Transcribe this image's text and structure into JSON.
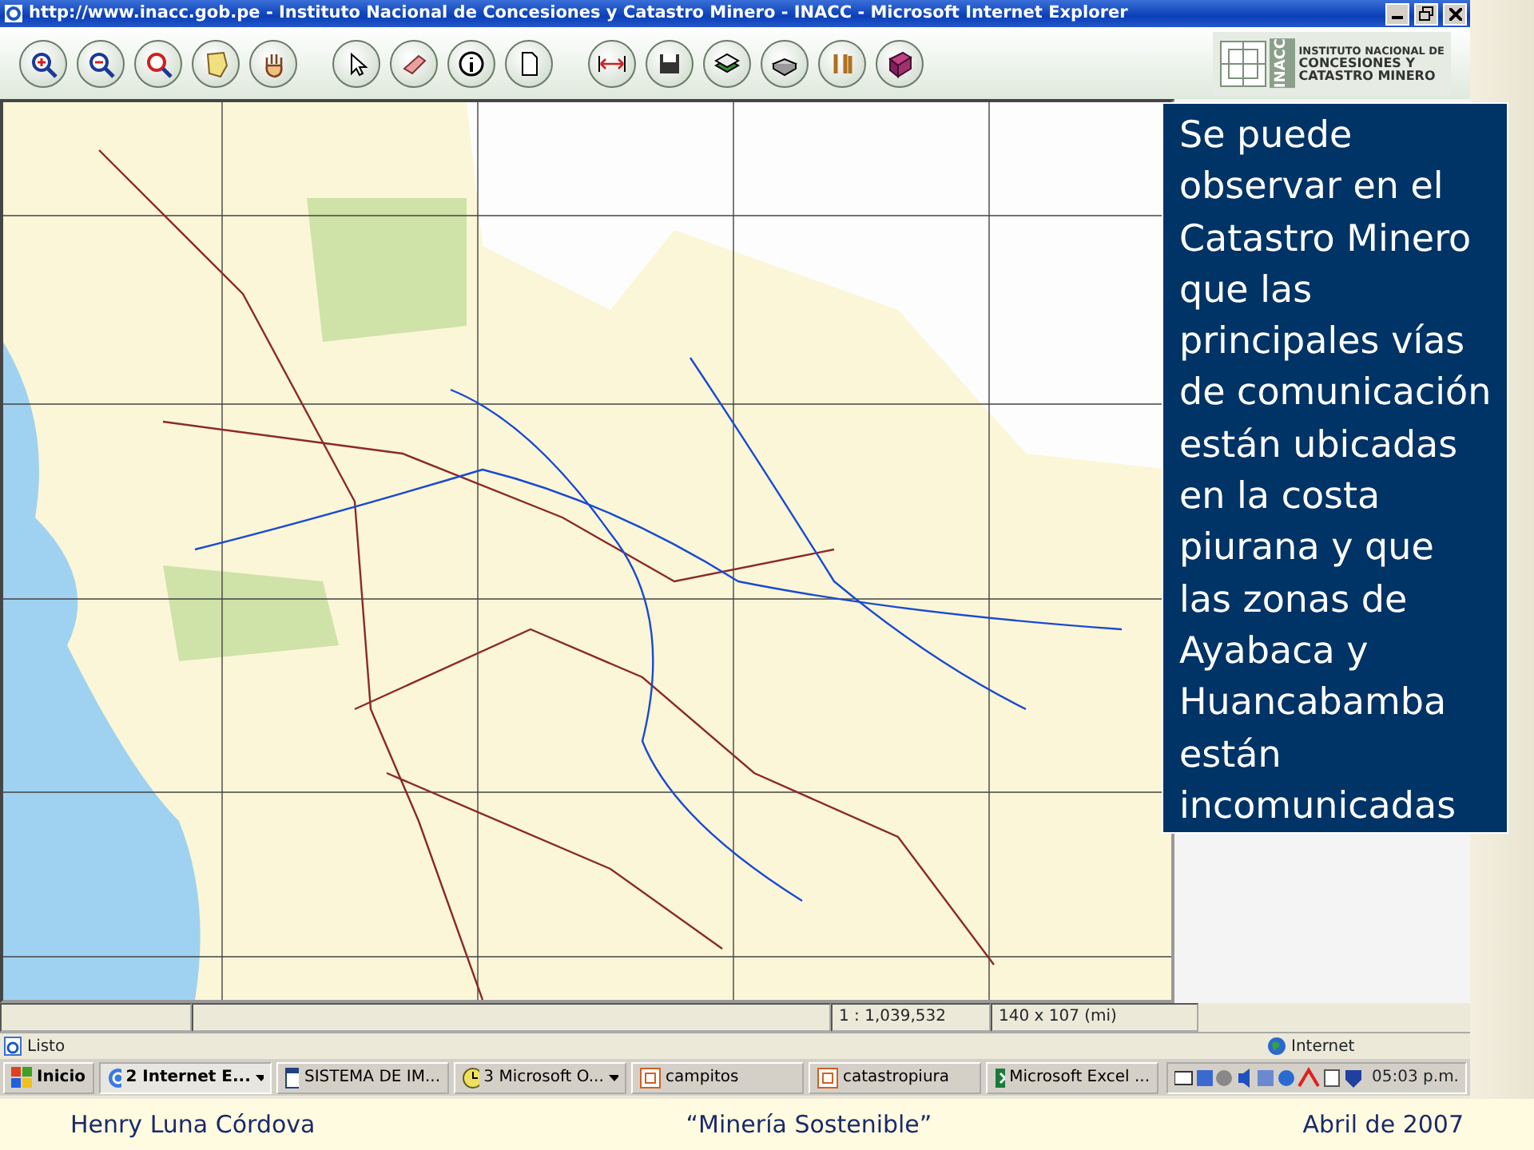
{
  "window": {
    "title": "http://www.inacc.gob.pe - Instituto Nacional de Concesiones y Catastro Minero - INACC - Microsoft Internet Explorer"
  },
  "logo": {
    "short": "INACC",
    "lines": [
      "INSTITUTO NACIONAL DE",
      "CONCESIONES Y",
      "CATASTRO MINERO"
    ]
  },
  "map": {
    "scale": "1 : 1,039,532",
    "size": "140 x 107 (mi)"
  },
  "callout": {
    "text": "Se puede observar en el Catastro Minero que las principales vías de comunicación están ubicadas en la costa piurana y que las zonas de Ayabaca y Huancabamba están incomunicadas"
  },
  "status_bar": {
    "text": "Listo",
    "zone": "Internet"
  },
  "taskbar": {
    "start": "Inicio",
    "tasks": [
      {
        "label": "2 Internet E...",
        "grouped": true,
        "selected": true,
        "kind": "browser"
      },
      {
        "label": "SISTEMA DE IM...",
        "grouped": false,
        "selected": false,
        "kind": "app"
      },
      {
        "label": "3 Microsoft O...",
        "grouped": true,
        "selected": false,
        "kind": "clock"
      },
      {
        "label": "campitos",
        "grouped": false,
        "selected": false,
        "kind": "doc"
      },
      {
        "label": "catastropiura",
        "grouped": false,
        "selected": false,
        "kind": "doc"
      },
      {
        "label": "Microsoft Excel ...",
        "grouped": false,
        "selected": false,
        "kind": "sheet"
      }
    ],
    "clock": "05:03 p.m."
  },
  "footer": {
    "left": "Henry Luna Córdova",
    "center": "“Minería Sostenible”",
    "right": "Abril de 2007"
  }
}
